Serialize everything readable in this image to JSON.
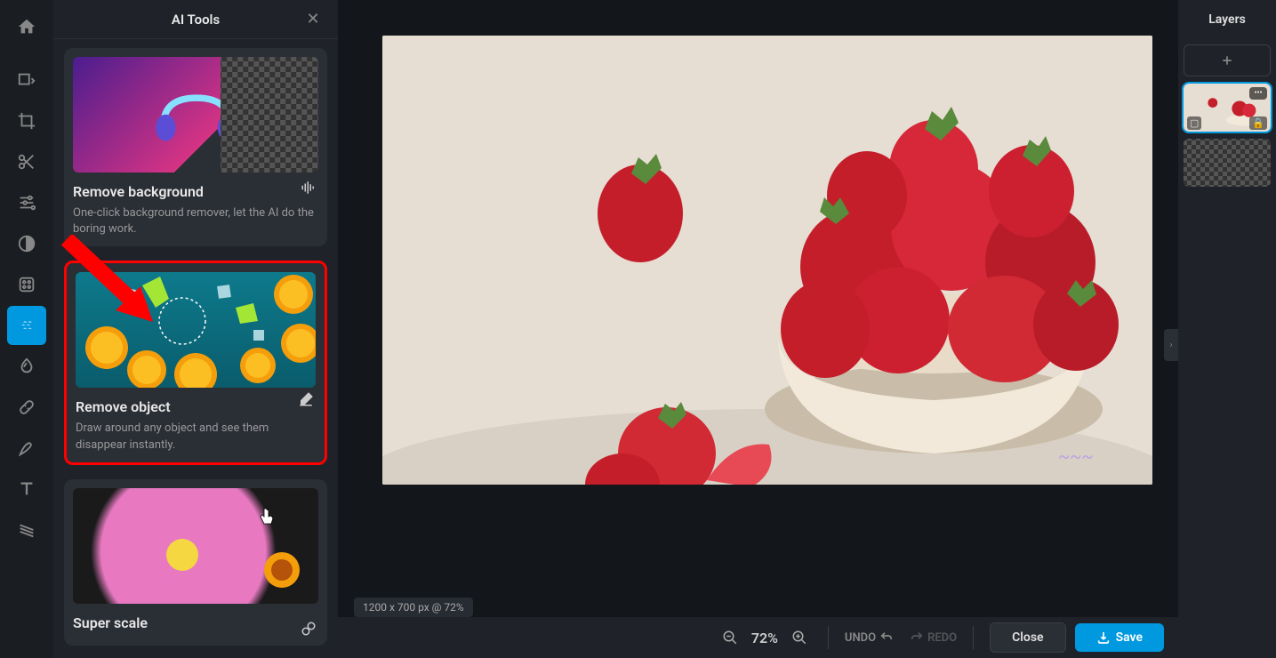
{
  "panel": {
    "title": "AI Tools",
    "tools": [
      {
        "title": "Remove background",
        "desc": "One-click background remover, let the AI do the boring work."
      },
      {
        "title": "Remove object",
        "desc": "Draw around any object and see them disappear instantly."
      },
      {
        "title": "Super scale",
        "desc": ""
      }
    ]
  },
  "canvas": {
    "status": "1200 x 700 px @ 72%"
  },
  "bottombar": {
    "zoom": "72%",
    "undo": "UNDO",
    "redo": "REDO",
    "close": "Close",
    "save": "Save"
  },
  "layers": {
    "title": "Layers"
  }
}
